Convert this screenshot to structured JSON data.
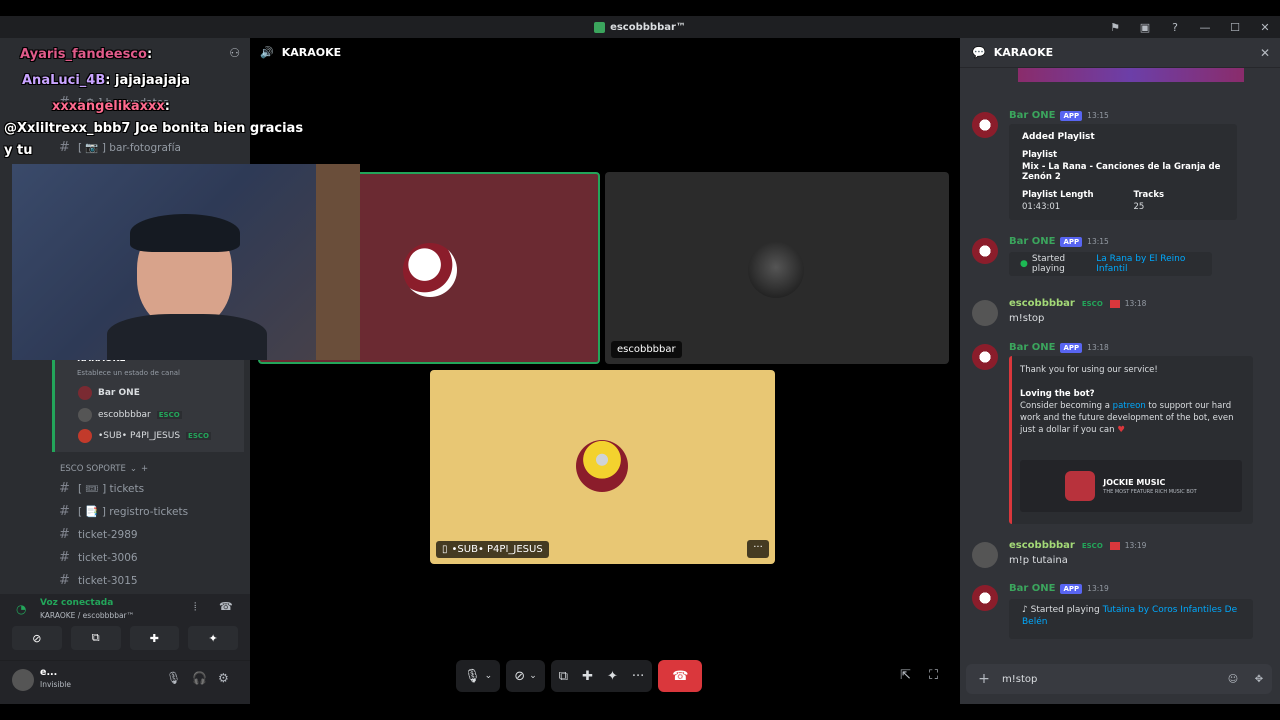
{
  "window": {
    "title": "escobbbbar™"
  },
  "overlay_chat": [
    {
      "user": "Ayaris_fandeesco",
      "text": "",
      "color": "#e05b8a"
    },
    {
      "user": "AnaLuci_4B",
      "text": "jajajaajaja",
      "color": "#c9a4ff"
    },
    {
      "user": "xxxangelikaxxx",
      "text": "",
      "color": "#ff6b8f"
    },
    {
      "user": "",
      "text": "@Xxliltrexx_bbb7 Joe bonita bien gracias",
      "color": "#ffffff"
    },
    {
      "user": "",
      "text": "y tu",
      "color": "#ffffff"
    }
  ],
  "sidebar": {
    "channels_top": [
      {
        "label": "[ ⚙ ] bar-updates"
      },
      {
        "label": "[ 📷 ] bar-fotografía"
      }
    ],
    "voice_channel": {
      "name": "KARAOKE",
      "status_hint": "Establece un estado de canal",
      "members": [
        {
          "name": "Bar ONE",
          "badge": ""
        },
        {
          "name": "escobbbbar",
          "badge": "ESCO"
        },
        {
          "name": "•SUB• P4PI_JESUS",
          "badge": "ESCO"
        }
      ]
    },
    "category": "ESCO SOPORTE",
    "channels_bottom": [
      {
        "label": "[ 🎟 ] tickets"
      },
      {
        "label": "[ 📑 ] registro-tickets"
      },
      {
        "label": "ticket-2989"
      },
      {
        "label": "ticket-3006"
      },
      {
        "label": "ticket-3015"
      }
    ],
    "voice_status": {
      "title": "Voz conectada",
      "detail": "KARAOKE / escobbbbar™"
    },
    "user": {
      "name": "e...",
      "status": "Invisible"
    }
  },
  "stage": {
    "channel": "KARAOKE",
    "tiles": [
      {
        "name": "",
        "bg": "#6b2a32"
      },
      {
        "name": "escobbbbar",
        "bg": "#2b2b2b"
      },
      {
        "name": "•SUB• P4PI_JESUS",
        "bg": "#e8c774"
      }
    ]
  },
  "chat": {
    "title": "KARAOKE",
    "messages": [
      {
        "user": "Bar ONE",
        "badge": "APP",
        "time": "13:15",
        "type": "embed_playlist",
        "embed": {
          "heading": "Added Playlist",
          "playlist_label": "Playlist",
          "playlist": "Mix - La Rana - Canciones de la Granja de Zenón 2",
          "length_label": "Playlist Length",
          "length": "01:43:01",
          "tracks_label": "Tracks",
          "tracks": "25"
        }
      },
      {
        "user": "Bar ONE",
        "badge": "APP",
        "time": "13:15",
        "type": "embed_playing",
        "embed": {
          "text": "Started playing",
          "link": "La Rana by El Reino Infantil"
        }
      },
      {
        "user": "escobbbbar",
        "badge": "ESCO",
        "time": "13:18",
        "text": "m!stop"
      },
      {
        "user": "Bar ONE",
        "badge": "APP",
        "time": "13:18",
        "type": "embed_thanks",
        "embed": {
          "line1": "Thank you for using our service!",
          "line2": "Loving the bot?",
          "line3a": "Consider becoming a ",
          "link": "patreon",
          "line3b": " to support our hard work and the future development of the bot, even just a dollar if you can",
          "banner_title": "JOCKIE MUSIC",
          "banner_sub": "THE MOST FEATURE RICH MUSIC BOT"
        }
      },
      {
        "user": "escobbbbar",
        "badge": "ESCO",
        "time": "13:19",
        "text": "m!p tutaina"
      },
      {
        "user": "Bar ONE",
        "badge": "APP",
        "time": "13:19",
        "type": "embed_playing",
        "embed": {
          "text": "Started playing",
          "link": "Tutaina by Coros Infantiles De Belén"
        }
      }
    ],
    "input_value": "m!stop"
  },
  "colors": {
    "accent": "#5865f2",
    "danger": "#da373c",
    "online": "#23a55a",
    "bot_name": "#3ba55d",
    "user_name": "#a3d977"
  }
}
